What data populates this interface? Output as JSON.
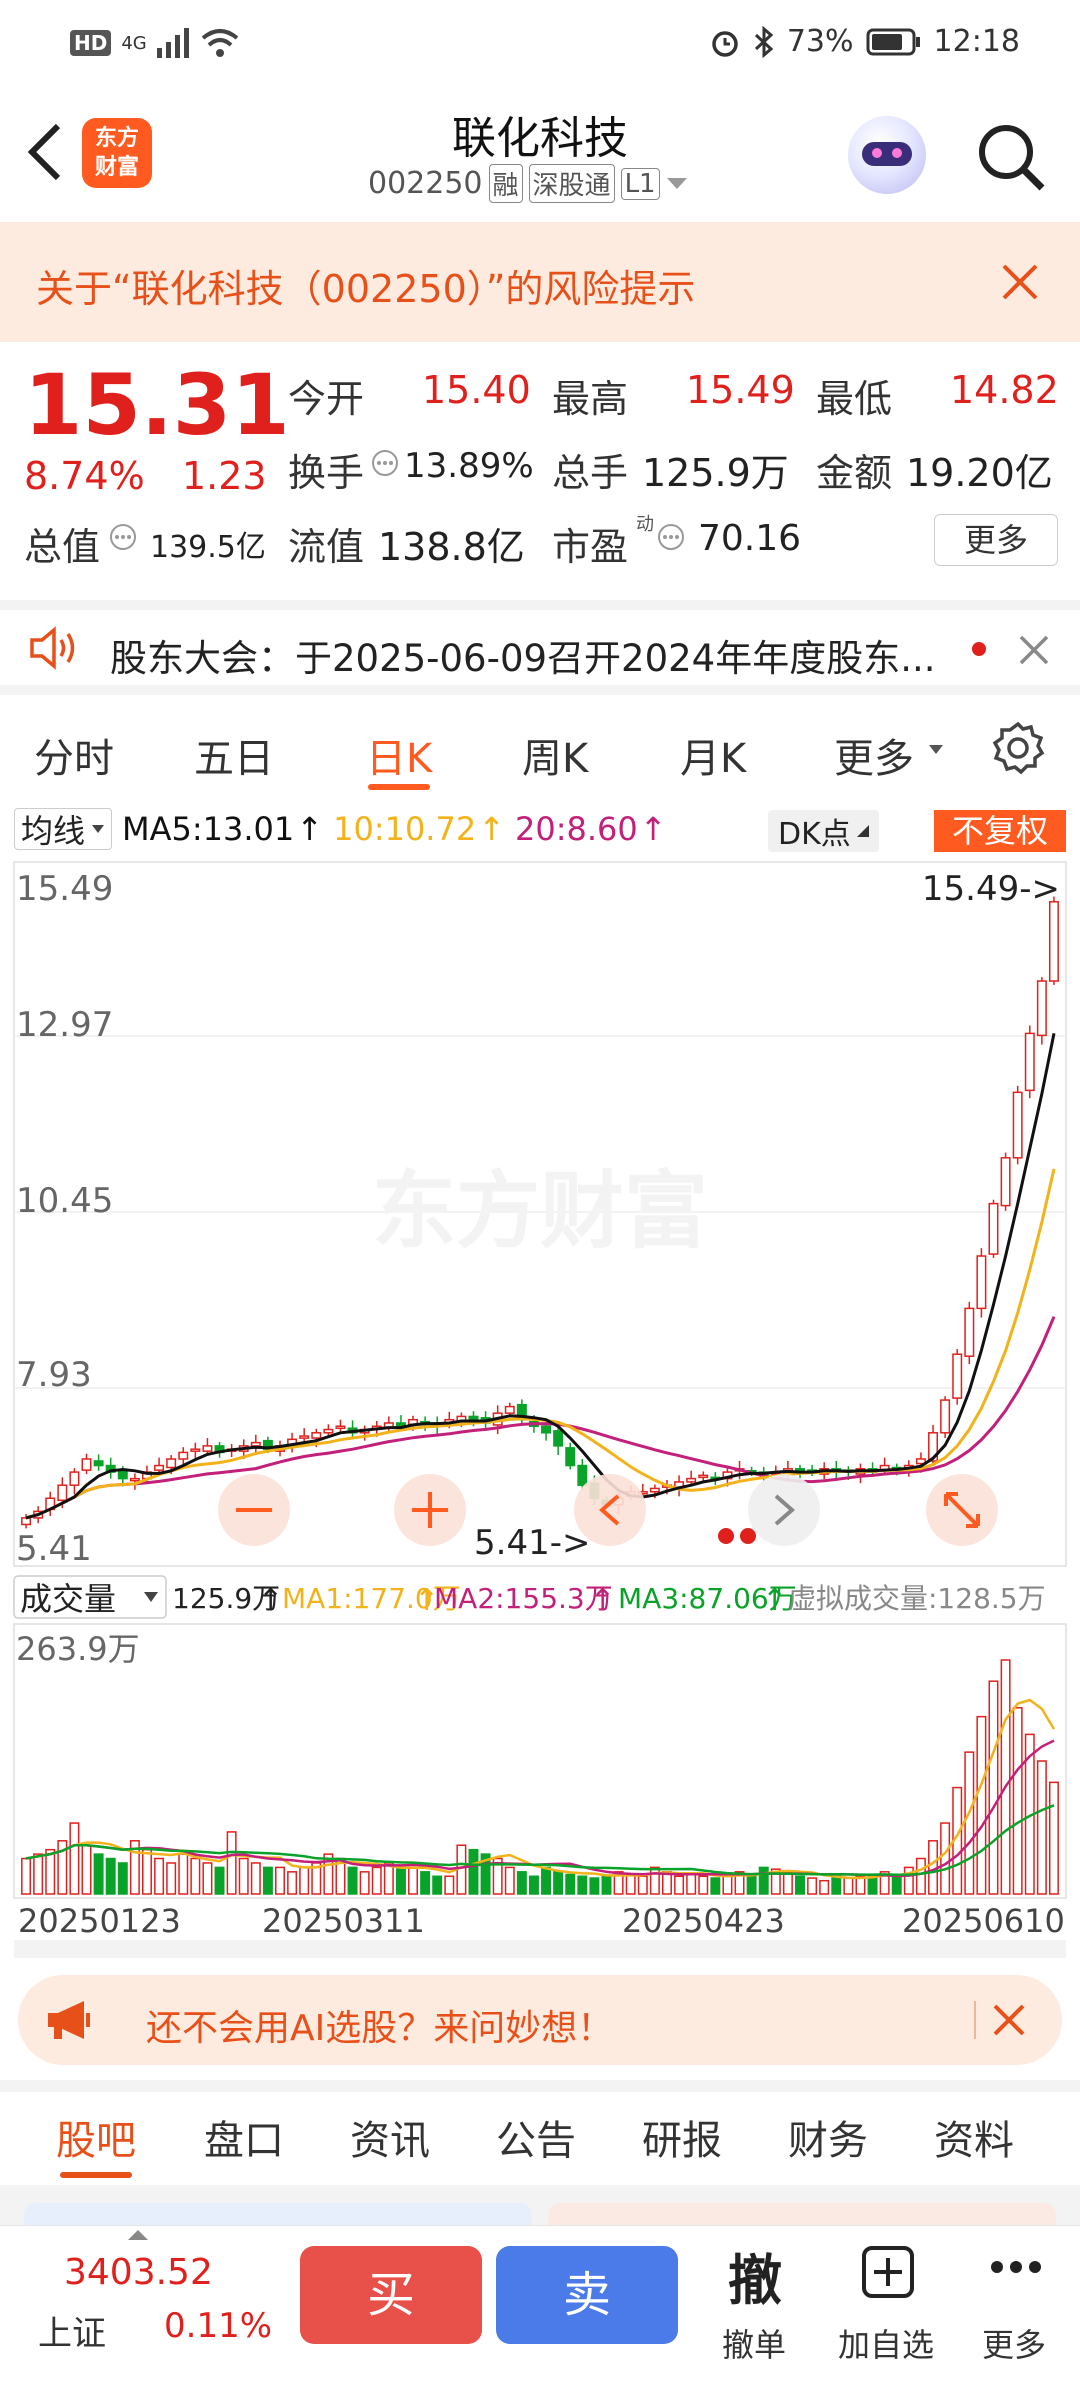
{
  "status_bar": {
    "left_badges": [
      "HD",
      "4G"
    ],
    "battery": "73%",
    "time": "12:18"
  },
  "header": {
    "logo_text": "东方\n财富",
    "stock_name": "联化科技",
    "stock_code": "002250",
    "badges": [
      "融",
      "深股通",
      "L1"
    ]
  },
  "risk_banner": {
    "text": "关于“联化科技（002250）”的风险提示"
  },
  "quote": {
    "price": "15.31",
    "change_pct": "8.74%",
    "change_abs": "1.23",
    "open_label": "今开",
    "open": "15.40",
    "high_label": "最高",
    "high": "15.49",
    "low_label": "最低",
    "low": "14.82",
    "turnover_label": "换手",
    "turnover": "13.89%",
    "volume_label": "总手",
    "volume": "125.9万",
    "amount_label": "金额",
    "amount": "19.20亿",
    "mktcap_label": "总值",
    "mktcap": "139.5亿",
    "float_label": "流值",
    "float": "138.8亿",
    "pe_label": "市盈",
    "pe_sup": "动",
    "pe": "70.16",
    "more_label": "更多"
  },
  "notice": {
    "text": "股东大会：于2025-06-09召开2024年年度股东..."
  },
  "period_tabs": [
    {
      "label": "分时"
    },
    {
      "label": "五日"
    },
    {
      "label": "日K",
      "active": true
    },
    {
      "label": "周K"
    },
    {
      "label": "月K"
    },
    {
      "label": "更多"
    }
  ],
  "chart_header": {
    "ma_selector": "均线",
    "ma5": "MA5:13.01",
    "ma10": "10:10.72",
    "ma20": "20:8.60",
    "dk_label": "DK点",
    "adjust_label": "不复权"
  },
  "price_axis": [
    "15.49",
    "12.97",
    "10.45",
    "7.93",
    "5.41"
  ],
  "price_annotations": {
    "high_marker": "15.49->",
    "low_marker": "5.41->"
  },
  "watermark": "东方财富",
  "volume_header": {
    "selector": "成交量",
    "vol": "125.9万",
    "ma1": "MA1:177.0万",
    "ma2": "MA2:155.3万",
    "ma3": "MA3:87.06万",
    "virtual": "虚拟成交量:128.5万"
  },
  "volume_axis_max": "263.9万",
  "date_axis": [
    "20250123",
    "20250311",
    "20250423",
    "20250610"
  ],
  "chart_data": {
    "type": "candlestick",
    "ylim": [
      5.41,
      15.49
    ],
    "series_colors": {
      "up": "#e0201c",
      "down": "#0aa32a",
      "ma5": "#111111",
      "ma10": "#f2b21a",
      "ma20": "#c2207a"
    },
    "close": [
      5.9,
      6.0,
      6.2,
      6.4,
      6.6,
      6.8,
      6.7,
      6.6,
      6.5,
      6.5,
      6.6,
      6.7,
      6.8,
      6.9,
      6.95,
      7.0,
      6.9,
      6.95,
      7.0,
      7.05,
      6.95,
      7.0,
      7.1,
      7.15,
      7.2,
      7.25,
      7.3,
      7.2,
      7.25,
      7.3,
      7.35,
      7.3,
      7.4,
      7.35,
      7.3,
      7.4,
      7.45,
      7.4,
      7.35,
      7.5,
      7.6,
      7.4,
      7.3,
      7.2,
      7.0,
      6.7,
      6.4,
      6.2,
      6.1,
      6.2,
      6.3,
      6.3,
      6.35,
      6.4,
      6.45,
      6.5,
      6.55,
      6.5,
      6.6,
      6.65,
      6.6,
      6.55,
      6.6,
      6.65,
      6.6,
      6.6,
      6.65,
      6.6,
      6.6,
      6.65,
      6.6,
      6.7,
      6.65,
      6.7,
      6.8,
      7.2,
      7.7,
      8.4,
      9.1,
      9.9,
      10.7,
      11.4,
      12.4,
      13.3,
      14.1,
      15.31
    ],
    "volume_wan": [
      40,
      45,
      50,
      60,
      80,
      55,
      45,
      40,
      35,
      60,
      50,
      40,
      35,
      45,
      40,
      35,
      30,
      70,
      40,
      35,
      30,
      30,
      25,
      30,
      35,
      45,
      40,
      30,
      25,
      30,
      35,
      28,
      30,
      25,
      20,
      20,
      55,
      50,
      45,
      40,
      30,
      25,
      20,
      30,
      25,
      22,
      20,
      18,
      20,
      25,
      22,
      20,
      30,
      25,
      20,
      22,
      20,
      18,
      20,
      25,
      22,
      30,
      28,
      25,
      20,
      18,
      15,
      20,
      18,
      20,
      22,
      25,
      20,
      30,
      40,
      60,
      80,
      120,
      160,
      200,
      240,
      263.9,
      210,
      180,
      150,
      125.9
    ]
  },
  "ai_banner": {
    "text": "还不会用AI选股？来问妙想！"
  },
  "bottom_tabs": [
    {
      "label": "股吧",
      "active": true
    },
    {
      "label": "盘口"
    },
    {
      "label": "资讯"
    },
    {
      "label": "公告"
    },
    {
      "label": "研报"
    },
    {
      "label": "财务"
    },
    {
      "label": "资料"
    }
  ],
  "index": {
    "value": "3403.52",
    "name": "上证",
    "change": "0.11%"
  },
  "actions": {
    "buy": "买",
    "sell": "卖",
    "cancel_icon": "撤",
    "cancel": "撤单",
    "add_watch": "加自选",
    "more": "更多"
  }
}
